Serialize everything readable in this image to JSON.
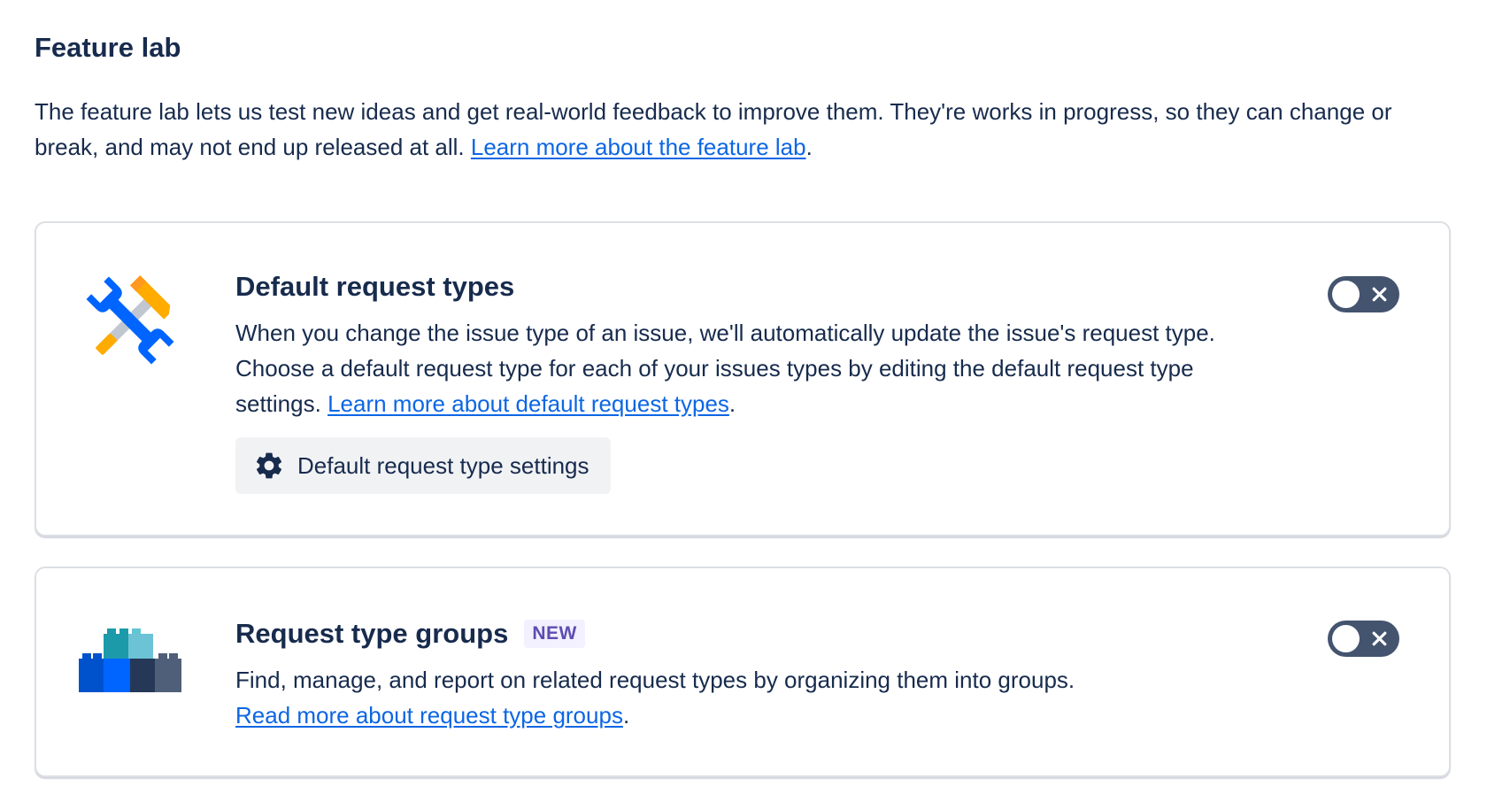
{
  "page": {
    "title": "Feature lab",
    "intro_text": "The feature lab lets us test new ideas and get real-world feedback to improve them. They're works in progress, so they can change or break, and may not end up released at all. ",
    "intro_link": "Learn more about the feature lab",
    "intro_end": "."
  },
  "features": [
    {
      "title": "Default request types",
      "icon": "tools-icon",
      "description": "When you change the issue type of an issue, we'll automatically update the issue's request type. Choose a default request type for each of your issues types by editing the default request type settings. ",
      "link": "Learn more about default request types",
      "link_end": ".",
      "button_label": "Default request type settings",
      "button_icon": "gear-icon",
      "toggle_enabled": false
    },
    {
      "title": "Request type groups",
      "badge": "NEW",
      "icon": "blocks-icon",
      "description": "Find, manage, and report on related request types by organizing them into groups.",
      "link": "Read more about request type groups",
      "link_end": ".",
      "toggle_enabled": false
    }
  ],
  "colors": {
    "text": "#172b4d",
    "link": "#0c66e4",
    "toggle_off": "#44546f",
    "badge_bg": "#f3f0ff",
    "badge_text": "#5e4db2",
    "button_bg": "#f1f2f4",
    "card_border": "#dcdfe4"
  }
}
